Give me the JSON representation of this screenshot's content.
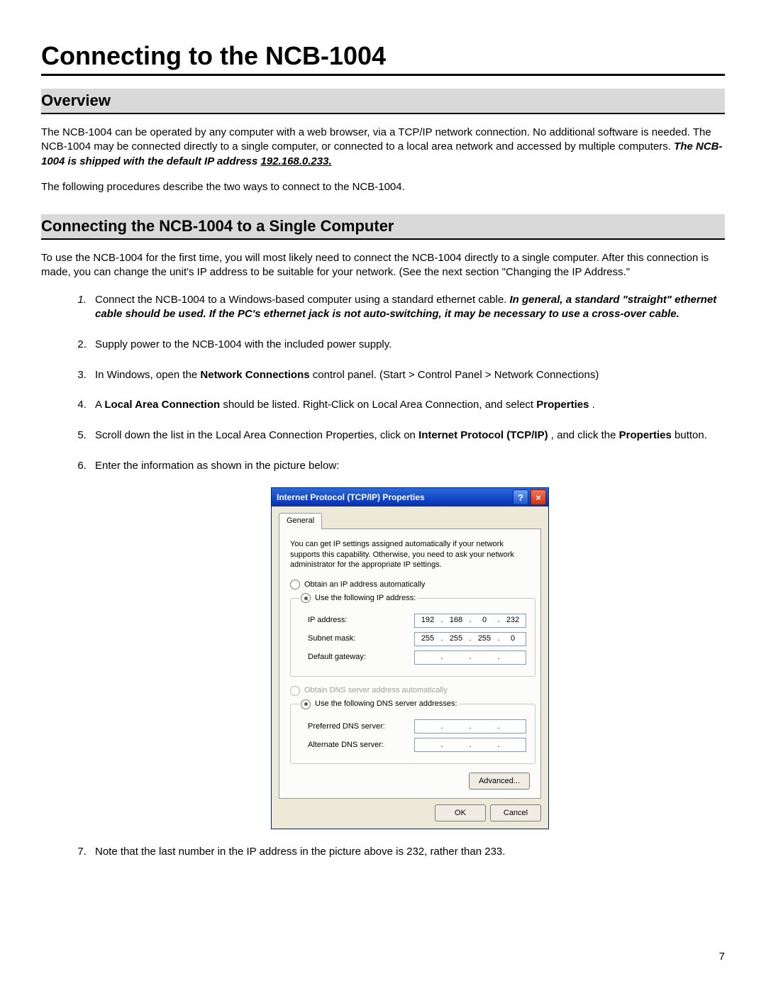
{
  "page_number": "7",
  "title": "Connecting to the NCB-1004",
  "sections": {
    "overview": {
      "heading": "Overview",
      "p1_a": "The NCB-1004 can be operated by any computer with a web browser, via a TCP/IP network connection. No additional software is needed. The NCB-1004 may be connected directly to a single computer, or connected to a local area network and accessed by multiple computers. ",
      "p1_b": "The NCB-1004 is shipped with the default IP address ",
      "p1_c": "192.168.0.233.",
      "p2": "The following procedures describe the two ways to connect to the NCB-1004."
    },
    "single": {
      "heading": "Connecting the NCB-1004 to a Single Computer",
      "intro": "To use the NCB-1004 for the first time, you will most likely need to connect the NCB-1004 directly to a single computer. After this connection is made, you can change the unit's IP address to be suitable for your network. (See the next section \"Changing the IP Address.\"",
      "step1_a": "Connect the NCB-1004 to a Windows-based computer using a standard ethernet cable. ",
      "step1_b": "In general, a standard \"straight\" ethernet cable should be used. If the PC's ethernet jack is not auto-switching, it may be necessary to use a cross-over cable.",
      "step2": "Supply power to the NCB-1004 with the included power supply.",
      "step3_a": "In Windows, open the ",
      "step3_b": "Network Connections",
      "step3_c": " control panel. (Start > Control Panel > Network Connections)",
      "step4_a": "A ",
      "step4_b": "Local Area Connection",
      "step4_c": " should be listed. Right-Click on Local Area Connection, and select ",
      "step4_d": "Properties",
      "step4_e": ".",
      "step5_a": "Scroll down the list in the Local Area Connection Properties, click on ",
      "step5_b": "Internet Protocol (TCP/IP)",
      "step5_c": ", and click the ",
      "step5_d": "Properties",
      "step5_e": " button.",
      "step6": "Enter the information as shown in the picture below:",
      "step7": "Note that the last number in the IP address in the picture above is 232, rather than 233."
    }
  },
  "dialog": {
    "title": "Internet Protocol (TCP/IP) Properties",
    "tab": "General",
    "intro": "You can get IP settings assigned automatically if your network supports this capability. Otherwise, you need to ask your network administrator for the appropriate IP settings.",
    "radio_auto_ip": "Obtain an IP address automatically",
    "radio_manual_ip": "Use the following IP address:",
    "label_ip": "IP address:",
    "label_subnet": "Subnet mask:",
    "label_gateway": "Default gateway:",
    "radio_auto_dns": "Obtain DNS server address automatically",
    "radio_manual_dns": "Use the following DNS server addresses:",
    "label_pref_dns": "Preferred DNS server:",
    "label_alt_dns": "Alternate DNS server:",
    "ip": {
      "a": "192",
      "b": "168",
      "c": "0",
      "d": "232"
    },
    "subnet": {
      "a": "255",
      "b": "255",
      "c": "255",
      "d": "0"
    },
    "btn_advanced": "Advanced...",
    "btn_ok": "OK",
    "btn_cancel": "Cancel"
  }
}
